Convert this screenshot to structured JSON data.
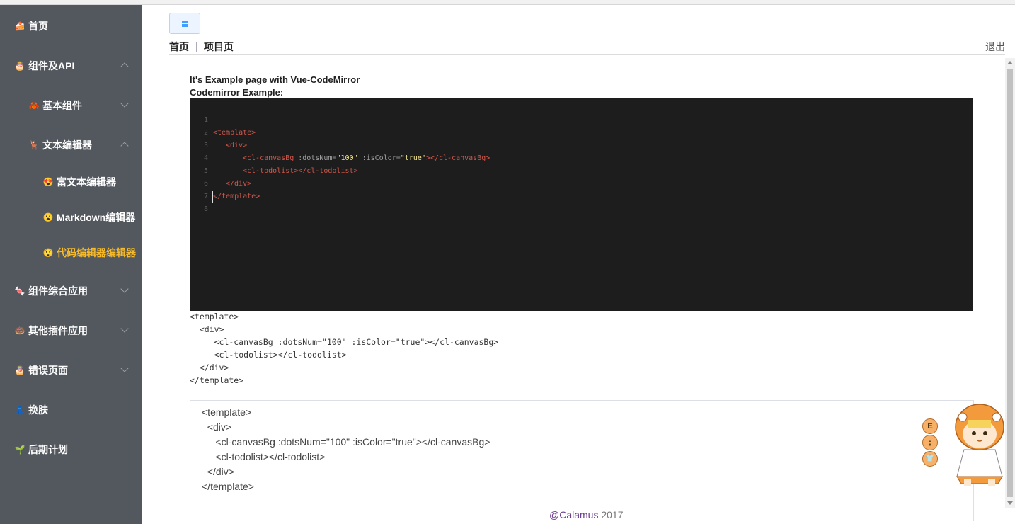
{
  "sidebar": {
    "items": [
      {
        "label": "首页",
        "icon": "cake-icon",
        "chevron": ""
      },
      {
        "label": "组件及API",
        "icon": "cake-icon",
        "chevron": "up"
      },
      {
        "label": "基本组件",
        "icon": "crab-icon",
        "chevron": "down"
      },
      {
        "label": "文本编辑器",
        "icon": "deer-icon",
        "chevron": "up"
      },
      {
        "label": "富文本编辑器",
        "icon": "emoji-icon",
        "chevron": ""
      },
      {
        "label": "Markdown编辑器",
        "icon": "emoji-icon",
        "chevron": ""
      },
      {
        "label": "代码编辑器编辑器",
        "icon": "emoji-icon",
        "chevron": ""
      },
      {
        "label": "组件综合应用",
        "icon": "candy-icon",
        "chevron": "down"
      },
      {
        "label": "其他插件应用",
        "icon": "cake-icon",
        "chevron": "down"
      },
      {
        "label": "错误页面",
        "icon": "cake-icon",
        "chevron": "down"
      },
      {
        "label": "换肤",
        "icon": "dress-icon",
        "chevron": ""
      },
      {
        "label": "后期计划",
        "icon": "plant-icon",
        "chevron": ""
      }
    ],
    "active_label": "代码编辑器编辑器"
  },
  "header": {
    "breadcrumb": [
      "首页",
      "项目页"
    ],
    "logout": "退出"
  },
  "main": {
    "heading1": "It's Example page with Vue-CodeMirror",
    "heading2": "Codemirror Example:",
    "editor": {
      "line_numbers": [
        "1",
        "2",
        "3",
        "4",
        "5",
        "6",
        "7",
        "8"
      ],
      "code": {
        "l1": "<template>",
        "l2_tag": "<div>",
        "l3_open": "<cl-canvasBg",
        "l3_attr1": " :dotsNum=",
        "l3_val1": "\"100\"",
        "l3_attr2": " :isColor=",
        "l3_val2": "\"true\"",
        "l3_close": "></cl-canvasBg>",
        "l4": "<cl-todolist></cl-todolist>",
        "l5": "</div>",
        "l6": "</template>"
      }
    },
    "pre_output": "<template>\n  <div>\n     <cl-canvasBg :dotsNum=\"100\" :isColor=\"true\"></cl-canvasBg>\n     <cl-todolist></cl-todolist>\n  </div>\n</template>",
    "textarea_value": "<template>\n  <div>\n     <cl-canvasBg :dotsNum=\"100\" :isColor=\"true\"></cl-canvasBg>\n     <cl-todolist></cl-todolist>\n  </div>\n</template>"
  },
  "footer": {
    "author": "@Calamus",
    "year": " 2017"
  },
  "mascot": {
    "bubbles": [
      "E",
      ";",
      "👕"
    ]
  },
  "colors": {
    "sidebar_bg": "#53585f",
    "active": "#f7ba2a",
    "editor_bg": "#1d1d1d",
    "accent": "#409eff"
  }
}
